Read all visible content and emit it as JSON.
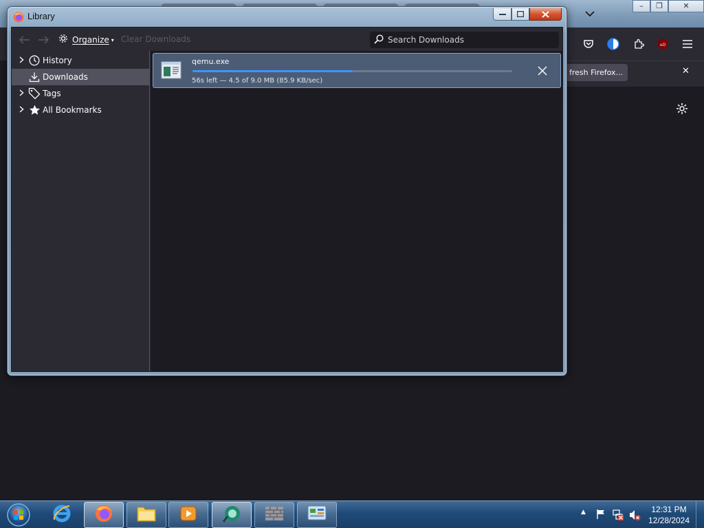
{
  "background_firefox": {
    "notification_button_label": "fresh Firefox...",
    "notification_close": "✕",
    "tab_list_chevron": "chevron-down-icon"
  },
  "library_window": {
    "title": "Library",
    "caption_buttons": [
      "minimize",
      "maximize",
      "close"
    ],
    "toolbar": {
      "back_icon": "arrow-left-icon",
      "forward_icon": "arrow-right-icon",
      "organize_label": "Organize",
      "clear_downloads_label": "Clear Downloads",
      "search_placeholder": "Search Downloads"
    },
    "sidebar": {
      "items": [
        {
          "label": "History",
          "icon": "clock-icon",
          "expandable": true,
          "selected": false
        },
        {
          "label": "Downloads",
          "icon": "download-icon",
          "expandable": false,
          "selected": true
        },
        {
          "label": "Tags",
          "icon": "tag-icon",
          "expandable": true,
          "selected": false
        },
        {
          "label": "All Bookmarks",
          "icon": "star-icon",
          "expandable": true,
          "selected": false
        }
      ]
    },
    "downloads": [
      {
        "filename": "qemu.exe",
        "status": "56s left — 4.5 of 9.0 MB (85.9 KB/sec)",
        "progress_percent": 50
      }
    ]
  },
  "taskbar": {
    "items": [
      "start-orb",
      "internet-explorer",
      "firefox",
      "file-explorer",
      "media-player",
      "app-green",
      "firewall-app",
      "control-panel"
    ],
    "clock_time": "12:31 PM",
    "clock_date": "12/28/2024"
  },
  "colors": {
    "accent": "#3b95ff",
    "library_bg": "#2b2a33",
    "pane_bg": "#1c1b22",
    "download_item_bg": "#4c5c75",
    "close_button": "#c1381a"
  }
}
